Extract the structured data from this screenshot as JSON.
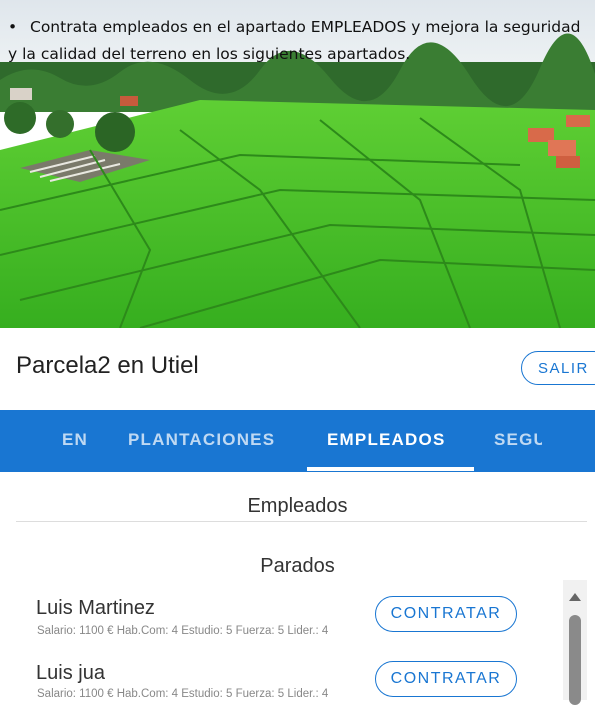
{
  "instruction": {
    "bullet": "•",
    "text": "Contrata empleados en el apartado EMPLEADOS y mejora la seguridad y la calidad del terreno en los siguientes apartados."
  },
  "header": {
    "title": "Parcela2 en Utiel",
    "exit_label": "SALIR"
  },
  "tabs": [
    {
      "label": "EN",
      "active": false
    },
    {
      "label": "PLANTACIONES",
      "active": false
    },
    {
      "label": "EMPLEADOS",
      "active": true
    },
    {
      "label": "SEGU",
      "active": false
    }
  ],
  "main": {
    "section_title": "Empleados",
    "subsection_title": "Parados",
    "employees": [
      {
        "name": "Luis Martinez",
        "stats": "Salario: 1100 € Hab.Com: 4 Estudio: 5 Fuerza: 5 Lider.: 4",
        "action_label": "CONTRATAR"
      },
      {
        "name": "Luis jua",
        "stats": "Salario: 1100 € Hab.Com: 4 Estudio: 5 Fuerza: 5 Lider.: 4",
        "action_label": "CONTRATAR"
      }
    ]
  },
  "colors": {
    "primary": "#1976d2",
    "field_green": "#4cc02a",
    "sky": "#e9eef2"
  },
  "icons": {
    "scroll_up": "triangle-up-icon"
  }
}
